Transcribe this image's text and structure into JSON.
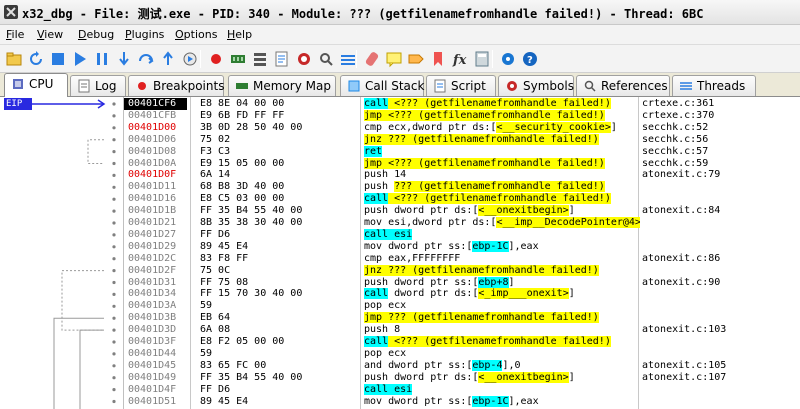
{
  "window": {
    "title": "x32_dbg - File: 测试.exe - PID: 340 - Module: ??? (getfilenamefromhandle failed!) - Thread: 6BC"
  },
  "menu": [
    {
      "label": "File",
      "u": "F"
    },
    {
      "label": "View",
      "u": "V"
    },
    {
      "label": "Debug",
      "u": "D"
    },
    {
      "label": "Plugins",
      "u": "P"
    },
    {
      "label": "Options",
      "u": "O"
    },
    {
      "label": "Help",
      "u": "H"
    }
  ],
  "toolbar_icons": [
    "open-icon",
    "restart-icon",
    "stop-icon",
    "run-icon",
    "pause-icon",
    "step-into-icon",
    "step-over-icon",
    "execute-till-return-icon",
    "run-to-user-code-icon",
    "breakpoint-icon",
    "memory-map-icon",
    "call-stack-icon",
    "script-icon",
    "symbols-icon",
    "references-icon",
    "threads-icon",
    "patch-icon",
    "comments-icon",
    "labels-icon",
    "bookmarks-icon",
    "functions-icon",
    "calculator-icon",
    "options-icon",
    "help-icon"
  ],
  "tabs": [
    {
      "label": "CPU",
      "icon": "cpu-icon",
      "active": true
    },
    {
      "label": "Log",
      "icon": "log-icon"
    },
    {
      "label": "Breakpoints",
      "icon": "breakpoint-dot-icon"
    },
    {
      "label": "Memory Map",
      "icon": "memory-map-icon"
    },
    {
      "label": "Call Stack",
      "icon": "call-stack-icon"
    },
    {
      "label": "Script",
      "icon": "script-icon"
    },
    {
      "label": "Symbols",
      "icon": "symbols-icon"
    },
    {
      "label": "References",
      "icon": "references-icon"
    },
    {
      "label": "Threads",
      "icon": "threads-icon"
    }
  ],
  "eip_label": "EIP",
  "colors": {
    "call": "#00ffff",
    "jump": "#ffff00",
    "red_address": "#e00000",
    "eip": "#2929e0"
  },
  "rows": [
    {
      "addr": "00401CF6",
      "bytes": "E8 8E 04 00 00",
      "instr": [
        {
          "t": "call",
          "c": "c"
        },
        {
          "t": " <??? (getfilenamefromhandle failed!)",
          "c": "y"
        }
      ],
      "info": "crtexe.c:361",
      "cur": true
    },
    {
      "addr": "00401CFB",
      "bytes": "E9 6B FD FF FF",
      "instr": [
        {
          "t": "jmp <??? (getfilenamefromhandle failed!)",
          "c": "y"
        }
      ],
      "info": "crtexe.c:370"
    },
    {
      "addr": "00401D00",
      "bytes": "3B 0D 28 50 40 00",
      "instr": [
        {
          "t": "cmp ecx,dword ptr ds:["
        },
        {
          "t": "<__security_cookie>",
          "c": "y"
        },
        {
          "t": "]"
        }
      ],
      "info": "secchk.c:52",
      "red": true
    },
    {
      "addr": "00401D06",
      "bytes": "75 02",
      "instr": [
        {
          "t": "jnz ??? (getfilenamefromhandle failed!)",
          "c": "y"
        }
      ],
      "info": "secchk.c:56"
    },
    {
      "addr": "00401D08",
      "bytes": "F3 C3",
      "instr": [
        {
          "t": "ret",
          "c": "c"
        }
      ],
      "info": "secchk.c:57"
    },
    {
      "addr": "00401D0A",
      "bytes": "E9 15 05 00 00",
      "instr": [
        {
          "t": "jmp <??? (getfilenamefromhandle failed!)",
          "c": "y"
        }
      ],
      "info": "secchk.c:59"
    },
    {
      "addr": "00401D0F",
      "bytes": "6A 14",
      "instr": [
        {
          "t": "push 14"
        }
      ],
      "info": "atonexit.c:79",
      "red": true
    },
    {
      "addr": "00401D11",
      "bytes": "68 B8 3D 40 00",
      "instr": [
        {
          "t": "push "
        },
        {
          "t": "??? (getfilenamefromhandle failed!)",
          "c": "y"
        }
      ],
      "info": ""
    },
    {
      "addr": "00401D16",
      "bytes": "E8 C5 03 00 00",
      "instr": [
        {
          "t": "call",
          "c": "c"
        },
        {
          "t": " <??? (getfilenamefromhandle failed!)",
          "c": "y"
        }
      ],
      "info": ""
    },
    {
      "addr": "00401D1B",
      "bytes": "FF 35 B4 55 40 00",
      "instr": [
        {
          "t": "push dword ptr ds:["
        },
        {
          "t": "<__onexitbegin>",
          "c": "y"
        },
        {
          "t": "]"
        }
      ],
      "info": "atonexit.c:84"
    },
    {
      "addr": "00401D21",
      "bytes": "8B 35 38 30 40 00",
      "instr": [
        {
          "t": "mov esi,dword ptr ds:["
        },
        {
          "t": "<__imp__DecodePointer@4>",
          "c": "y"
        },
        {
          "t": "]"
        }
      ],
      "info": ""
    },
    {
      "addr": "00401D27",
      "bytes": "FF D6",
      "instr": [
        {
          "t": "call esi",
          "c": "c"
        }
      ],
      "info": ""
    },
    {
      "addr": "00401D29",
      "bytes": "89 45 E4",
      "instr": [
        {
          "t": "mov dword ptr ss:["
        },
        {
          "t": "ebp-1C",
          "c": "c"
        },
        {
          "t": "],eax"
        }
      ],
      "info": ""
    },
    {
      "addr": "00401D2C",
      "bytes": "83 F8 FF",
      "instr": [
        {
          "t": "cmp eax,FFFFFFFF"
        }
      ],
      "info": "atonexit.c:86"
    },
    {
      "addr": "00401D2F",
      "bytes": "75 0C",
      "instr": [
        {
          "t": "jnz ??? (getfilenamefromhandle failed!)",
          "c": "y"
        }
      ],
      "info": ""
    },
    {
      "addr": "00401D31",
      "bytes": "FF 75 08",
      "instr": [
        {
          "t": "push dword ptr ss:["
        },
        {
          "t": "ebp+8",
          "c": "c"
        },
        {
          "t": "]"
        }
      ],
      "info": "atonexit.c:90"
    },
    {
      "addr": "00401D34",
      "bytes": "FF 15 70 30 40 00",
      "instr": [
        {
          "t": "call",
          "c": "c"
        },
        {
          "t": " dword ptr ds:["
        },
        {
          "t": "<_imp___onexit>",
          "c": "y"
        },
        {
          "t": "]"
        }
      ],
      "info": ""
    },
    {
      "addr": "00401D3A",
      "bytes": "59",
      "instr": [
        {
          "t": "pop ecx"
        }
      ],
      "info": ""
    },
    {
      "addr": "00401D3B",
      "bytes": "EB 64",
      "instr": [
        {
          "t": "jmp ??? (getfilenamefromhandle failed!)",
          "c": "y"
        }
      ],
      "info": ""
    },
    {
      "addr": "00401D3D",
      "bytes": "6A 08",
      "instr": [
        {
          "t": "push 8"
        }
      ],
      "info": "atonexit.c:103"
    },
    {
      "addr": "00401D3F",
      "bytes": "E8 F2 05 00 00",
      "instr": [
        {
          "t": "call",
          "c": "c"
        },
        {
          "t": " <??? (getfilenamefromhandle failed!)",
          "c": "y"
        }
      ],
      "info": ""
    },
    {
      "addr": "00401D44",
      "bytes": "59",
      "instr": [
        {
          "t": "pop ecx"
        }
      ],
      "info": ""
    },
    {
      "addr": "00401D45",
      "bytes": "83 65 FC 00",
      "instr": [
        {
          "t": "and dword ptr ss:["
        },
        {
          "t": "ebp-4",
          "c": "c"
        },
        {
          "t": "],0"
        }
      ],
      "info": "atonexit.c:105"
    },
    {
      "addr": "00401D49",
      "bytes": "FF 35 B4 55 40 00",
      "instr": [
        {
          "t": "push dword ptr ds:["
        },
        {
          "t": "<__onexitbegin>",
          "c": "y"
        },
        {
          "t": "]"
        }
      ],
      "info": "atonexit.c:107"
    },
    {
      "addr": "00401D4F",
      "bytes": "FF D6",
      "instr": [
        {
          "t": "call esi",
          "c": "c"
        }
      ],
      "info": ""
    },
    {
      "addr": "00401D51",
      "bytes": "89 45 E4",
      "instr": [
        {
          "t": "mov dword ptr ss:["
        },
        {
          "t": "ebp-1C",
          "c": "c"
        },
        {
          "t": "],eax"
        }
      ],
      "info": ""
    }
  ]
}
